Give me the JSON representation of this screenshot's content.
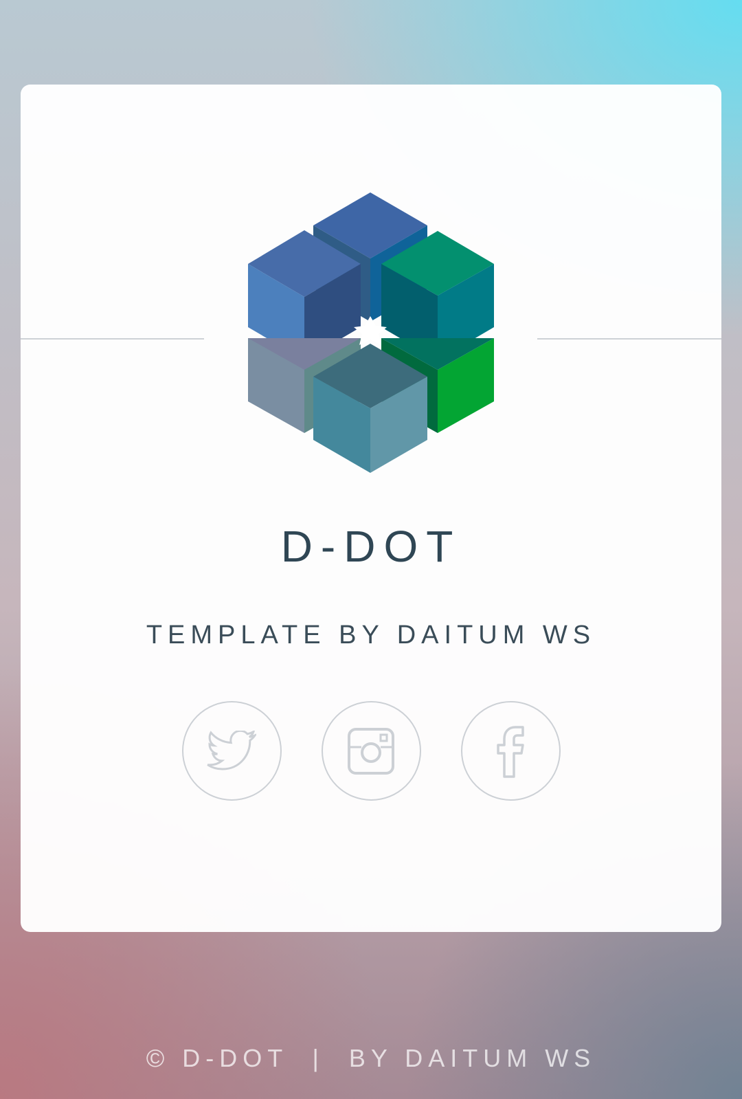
{
  "brand": {
    "title": "D-DOT",
    "subtitle": "TEMPLATE BY DAITUM WS",
    "logo_icon": "cube-cluster-logo"
  },
  "socials": [
    {
      "name": "twitter",
      "icon": "twitter-icon"
    },
    {
      "name": "instagram",
      "icon": "instagram-icon"
    },
    {
      "name": "facebook",
      "icon": "facebook-icon"
    }
  ],
  "footer": {
    "text": "© D-DOT  |  BY DAITUM WS"
  },
  "colors": {
    "title_text": "#2f4654",
    "icon_outline": "#ccd0d5",
    "card_background": "#ffffff"
  }
}
